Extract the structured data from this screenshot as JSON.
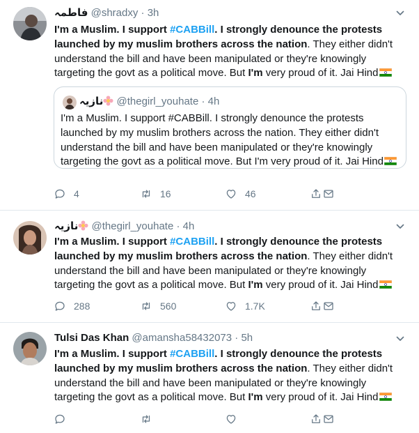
{
  "tweets": [
    {
      "name": "فاطمہ",
      "handle": "@shradxy",
      "time": "3h",
      "text": {
        "p1": "I'm a Muslim. I support ",
        "hashtag": "#CABBill",
        "p2": ". I strongly denounce the protests",
        "p3": " launched by my muslim brothers across the nation",
        "p4": ". They either didn't understand the bill and have been manipulated or they're knowingly targeting the govt as a political move. But ",
        "p5": "I'm",
        "p6": " very proud of it. Jai Hind"
      },
      "quote": {
        "name": "نازیہ",
        "handle": "@thegirl_youhate",
        "time": "4h",
        "text": "I'm a Muslim. I support #CABBill. I strongly denounce the protests launched by my muslim brothers across the nation. They either didn't understand the bill and have been manipulated or they're knowingly targeting the govt as a political move. But I'm very proud of it. Jai Hind"
      },
      "replies": "4",
      "retweets": "16",
      "likes": "46"
    },
    {
      "name": "نازیہ",
      "handle": "@thegirl_youhate",
      "time": "4h",
      "text": {
        "p1": "I'm a Muslim. I support ",
        "hashtag": "#CABBill",
        "p2": ". I strongly denounce the protests",
        "p3": " launched by my muslim brothers across the nation",
        "p4": ". They either didn't understand the bill and have been manipulated or they're knowingly targeting the govt as a political move. But ",
        "p5": "I'm",
        "p6": " very proud of it. Jai Hind"
      },
      "replies": "288",
      "retweets": "560",
      "likes": "1.7K"
    },
    {
      "name": "Tulsi Das Khan",
      "handle": "@amansha58432073",
      "time": "5h",
      "text": {
        "p1": "I'm a Muslim. I support ",
        "hashtag": "#CABBill",
        "p2": ". I strongly denounce the protests",
        "p3": " launched by my muslim brothers across the nation",
        "p4": ". They either didn't understand the bill and have been manipulated or they're knowingly targeting the govt as a political move. But ",
        "p5": "I'm",
        "p6": " very proud of it. Jai Hind"
      },
      "replies": "",
      "retweets": "",
      "likes": ""
    }
  ],
  "separator": "·",
  "icons": {
    "reply": "reply-icon",
    "retweet": "retweet-icon",
    "like": "heart-icon",
    "share": "share-icon",
    "dm": "dm-icon",
    "caret": "chevron-down-icon",
    "flag": "india-flag-icon",
    "flower": "flower-emoji-icon"
  },
  "colors": {
    "hashtag": "#1da1f2",
    "muted": "#657786",
    "divider": "#e1e8ed"
  }
}
